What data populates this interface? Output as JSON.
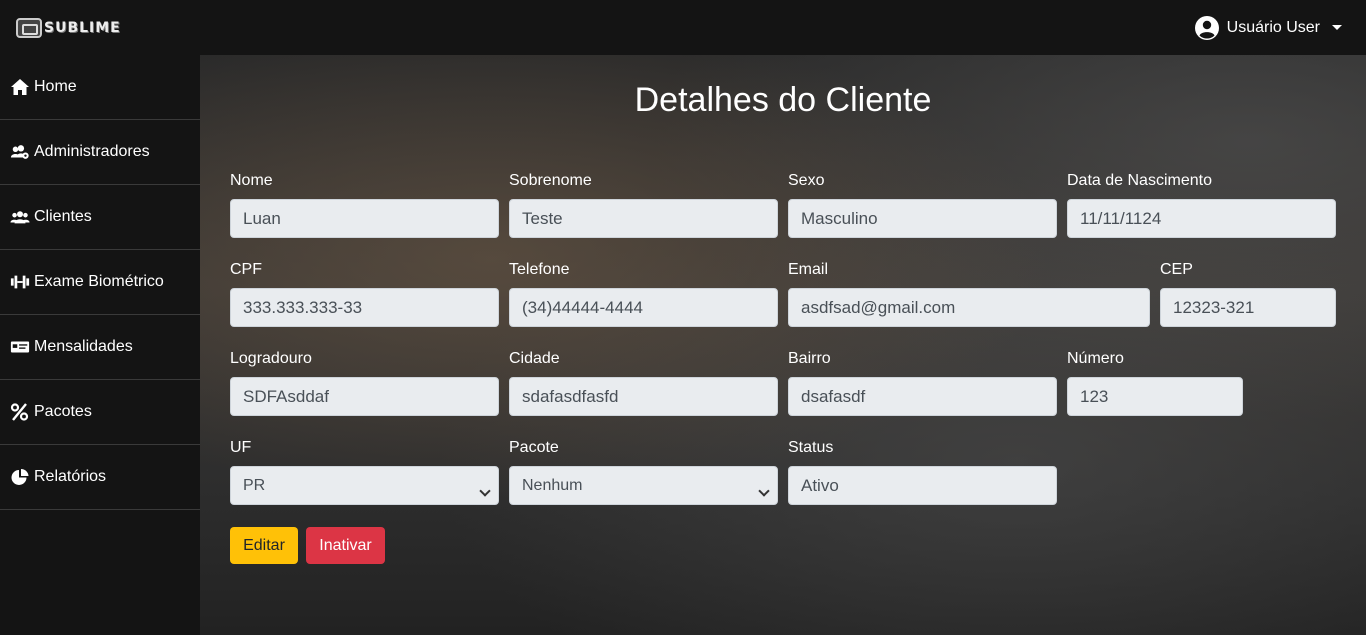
{
  "brand": {
    "name": "SUBLIME"
  },
  "user_menu": {
    "label": "Usuário User"
  },
  "sidebar": {
    "items": [
      {
        "label": "Home",
        "icon": "home-icon"
      },
      {
        "label": "Administradores",
        "icon": "users-cog-icon"
      },
      {
        "label": "Clientes",
        "icon": "users-icon"
      },
      {
        "label": "Exame Biométrico",
        "icon": "dumbbell-icon"
      },
      {
        "label": "Mensalidades",
        "icon": "money-card-icon"
      },
      {
        "label": "Pacotes",
        "icon": "percent-icon"
      },
      {
        "label": "Relatórios",
        "icon": "pie-chart-icon"
      }
    ]
  },
  "main": {
    "title": "Detalhes do Cliente",
    "fields": {
      "nome": {
        "label": "Nome",
        "value": "Luan"
      },
      "sobrenome": {
        "label": "Sobrenome",
        "value": "Teste"
      },
      "sexo": {
        "label": "Sexo",
        "value": "Masculino"
      },
      "nascimento": {
        "label": "Data de Nascimento",
        "value": "11/11/1124"
      },
      "cpf": {
        "label": "CPF",
        "value": "333.333.333-33"
      },
      "telefone": {
        "label": "Telefone",
        "value": "(34)44444-4444"
      },
      "email": {
        "label": "Email",
        "value": "asdfsad@gmail.com"
      },
      "cep": {
        "label": "CEP",
        "value": "12323-321"
      },
      "logradouro": {
        "label": "Logradouro",
        "value": "SDFAsddaf"
      },
      "cidade": {
        "label": "Cidade",
        "value": "sdafasdfasfd"
      },
      "bairro": {
        "label": "Bairro",
        "value": "dsafasdf"
      },
      "numero": {
        "label": "Número",
        "value": "123"
      },
      "uf": {
        "label": "UF",
        "value": "PR"
      },
      "pacote": {
        "label": "Pacote",
        "value": "Nenhum"
      },
      "status": {
        "label": "Status",
        "value": "Ativo"
      }
    },
    "buttons": {
      "edit": "Editar",
      "inactivate": "Inativar"
    }
  },
  "colors": {
    "edit_button": "#ffc107",
    "inactivate_button": "#dc3545",
    "sidebar_bg": "#141414"
  }
}
